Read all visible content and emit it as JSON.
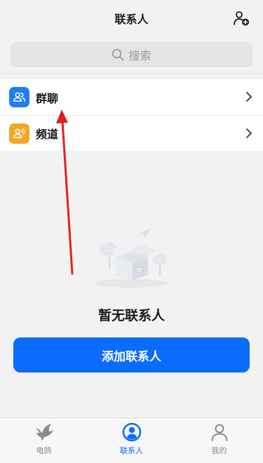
{
  "header": {
    "title": "联系人",
    "add_icon": "add-user-icon"
  },
  "search": {
    "placeholder": "搜索",
    "icon": "search-icon"
  },
  "list": {
    "items": [
      {
        "label": "群聊",
        "icon": "group-icon",
        "icon_color": "#1e7cf7"
      },
      {
        "label": "频道",
        "icon": "channel-icon",
        "icon_color": "#f5a623"
      }
    ]
  },
  "empty": {
    "text": "暂无联系人"
  },
  "add_button": {
    "label": "添加联系人",
    "color": "#0a6cff"
  },
  "tabbar": {
    "tabs": [
      {
        "label": "电鸽",
        "icon": "dove-icon",
        "active": false
      },
      {
        "label": "联系人",
        "icon": "contacts-icon",
        "active": true
      },
      {
        "label": "我的",
        "icon": "profile-icon",
        "active": false
      }
    ],
    "active_color": "#0a6cff"
  }
}
